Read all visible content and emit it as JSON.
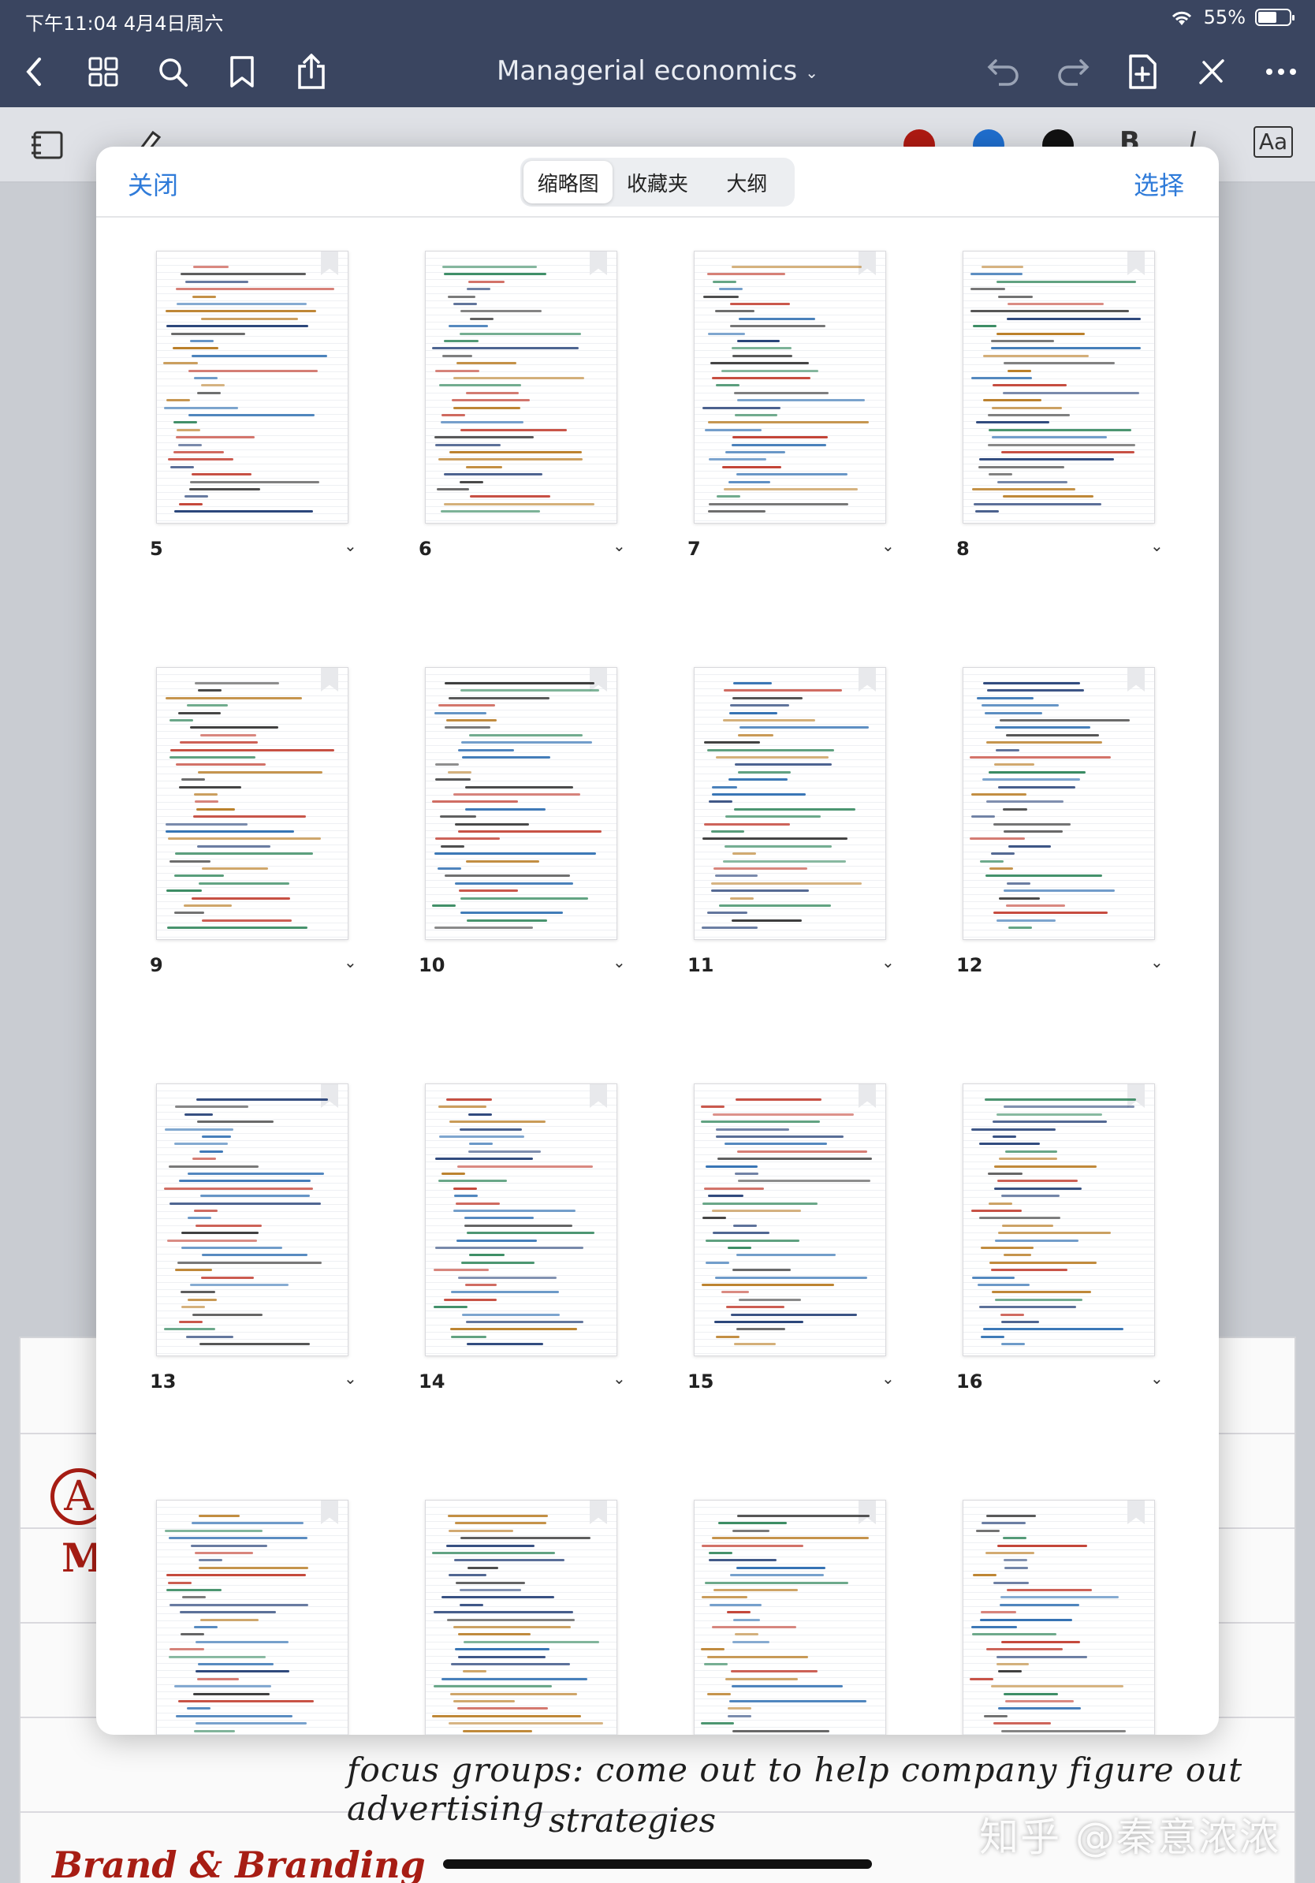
{
  "status": {
    "time": "下午11:04",
    "date": "4月4日周六",
    "battery": "55%"
  },
  "nav": {
    "title": "Managerial economics",
    "icons": [
      "back-icon",
      "grid-icon",
      "search-icon",
      "bookmark-icon",
      "share-icon",
      "undo-icon",
      "redo-icon",
      "add-page-icon",
      "close-tools-icon",
      "more-icon"
    ]
  },
  "toolbar": {
    "colors": {
      "red": "#b01a12",
      "blue": "#1f6fd0",
      "black": "#111111"
    },
    "bold_label": "B",
    "italic_label": "I",
    "text_style_label": "Aa"
  },
  "sheet": {
    "close_label": "关闭",
    "select_label": "选择",
    "tabs": [
      "缩略图",
      "收藏夹",
      "大纲"
    ],
    "active_tab": 0
  },
  "thumbnails": [
    {
      "page": "5"
    },
    {
      "page": "6"
    },
    {
      "page": "7"
    },
    {
      "page": "8"
    },
    {
      "page": "9"
    },
    {
      "page": "10"
    },
    {
      "page": "11"
    },
    {
      "page": "12"
    },
    {
      "page": "13"
    },
    {
      "page": "14"
    },
    {
      "page": "15"
    },
    {
      "page": "16"
    },
    {
      "page": ""
    },
    {
      "page": ""
    },
    {
      "page": ""
    },
    {
      "page": ""
    }
  ],
  "background_note": {
    "line1": "focus groups: come out to help company figure out advertising",
    "line2": "strategies",
    "heading": "Brand & Branding",
    "side_letters": "A",
    "side_letters2": "M"
  },
  "watermark": "知乎 @秦意浓浓",
  "accent": "#2f7bd9"
}
